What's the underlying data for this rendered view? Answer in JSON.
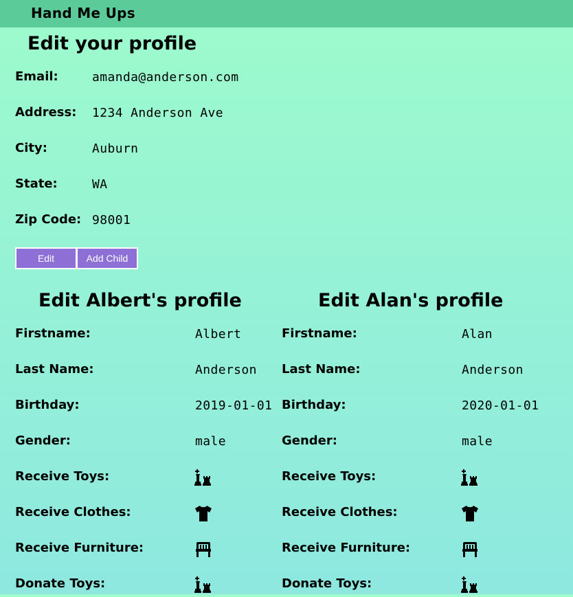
{
  "app": {
    "brand": "Hand Me Ups"
  },
  "profile": {
    "title": "Edit your profile",
    "fields": [
      {
        "label": "Email:",
        "value": "amanda@anderson.com"
      },
      {
        "label": "Address:",
        "value": "1234 Anderson Ave"
      },
      {
        "label": "City:",
        "value": "Auburn"
      },
      {
        "label": "State:",
        "value": "WA"
      },
      {
        "label": "Zip Code:",
        "value": "98001"
      }
    ],
    "buttons": {
      "edit": "Edit",
      "add_child": "Add Child"
    }
  },
  "children": [
    {
      "title": "Edit Albert's profile",
      "fields": [
        {
          "label": "Firstname:",
          "value": "Albert"
        },
        {
          "label": "Last Name:",
          "value": "Anderson"
        },
        {
          "label": "Birthday:",
          "value": "2019-01-01"
        },
        {
          "label": "Gender:",
          "value": "male"
        }
      ],
      "preferences": [
        {
          "label": "Receive Toys:",
          "icon": "chess-icon"
        },
        {
          "label": "Receive Clothes:",
          "icon": "tshirt-icon"
        },
        {
          "label": "Receive Furniture:",
          "icon": "chair-icon"
        },
        {
          "label": "Donate Toys:",
          "icon": "chess-icon"
        }
      ]
    },
    {
      "title": "Edit Alan's profile",
      "fields": [
        {
          "label": "Firstname:",
          "value": "Alan"
        },
        {
          "label": "Last Name:",
          "value": "Anderson"
        },
        {
          "label": "Birthday:",
          "value": "2020-01-01"
        },
        {
          "label": "Gender:",
          "value": "male"
        }
      ],
      "preferences": [
        {
          "label": "Receive Toys:",
          "icon": "chess-icon"
        },
        {
          "label": "Receive Clothes:",
          "icon": "tshirt-icon"
        },
        {
          "label": "Receive Furniture:",
          "icon": "chair-icon"
        },
        {
          "label": "Donate Toys:",
          "icon": "chess-icon"
        }
      ]
    }
  ],
  "colors": {
    "topbar": "#5ccb9a",
    "button": "#8e6fd6"
  }
}
